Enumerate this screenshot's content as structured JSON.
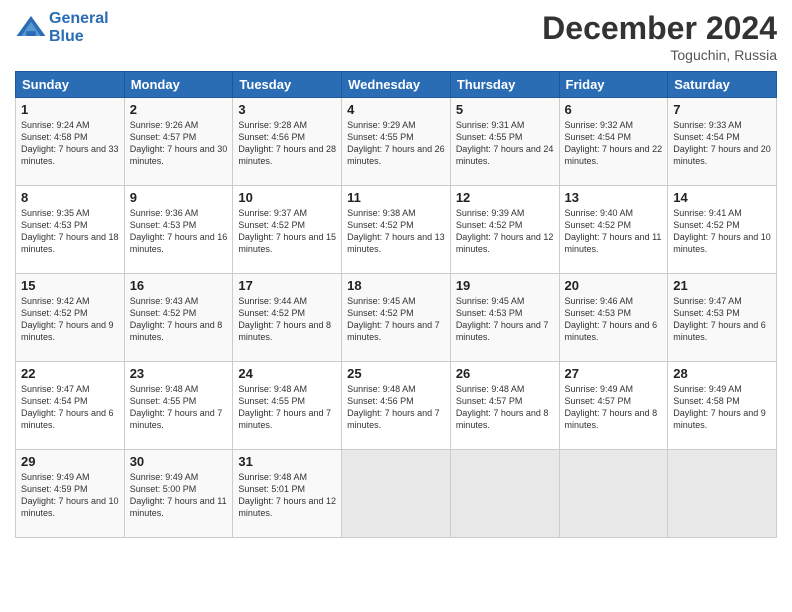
{
  "header": {
    "logo_line1": "General",
    "logo_line2": "Blue",
    "month": "December 2024",
    "location": "Toguchin, Russia"
  },
  "days_of_week": [
    "Sunday",
    "Monday",
    "Tuesday",
    "Wednesday",
    "Thursday",
    "Friday",
    "Saturday"
  ],
  "weeks": [
    [
      {
        "day": "1",
        "sunrise": "9:24 AM",
        "sunset": "4:58 PM",
        "daylight": "7 hours and 33 minutes."
      },
      {
        "day": "2",
        "sunrise": "9:26 AM",
        "sunset": "4:57 PM",
        "daylight": "7 hours and 30 minutes."
      },
      {
        "day": "3",
        "sunrise": "9:28 AM",
        "sunset": "4:56 PM",
        "daylight": "7 hours and 28 minutes."
      },
      {
        "day": "4",
        "sunrise": "9:29 AM",
        "sunset": "4:55 PM",
        "daylight": "7 hours and 26 minutes."
      },
      {
        "day": "5",
        "sunrise": "9:31 AM",
        "sunset": "4:55 PM",
        "daylight": "7 hours and 24 minutes."
      },
      {
        "day": "6",
        "sunrise": "9:32 AM",
        "sunset": "4:54 PM",
        "daylight": "7 hours and 22 minutes."
      },
      {
        "day": "7",
        "sunrise": "9:33 AM",
        "sunset": "4:54 PM",
        "daylight": "7 hours and 20 minutes."
      }
    ],
    [
      {
        "day": "8",
        "sunrise": "9:35 AM",
        "sunset": "4:53 PM",
        "daylight": "7 hours and 18 minutes."
      },
      {
        "day": "9",
        "sunrise": "9:36 AM",
        "sunset": "4:53 PM",
        "daylight": "7 hours and 16 minutes."
      },
      {
        "day": "10",
        "sunrise": "9:37 AM",
        "sunset": "4:52 PM",
        "daylight": "7 hours and 15 minutes."
      },
      {
        "day": "11",
        "sunrise": "9:38 AM",
        "sunset": "4:52 PM",
        "daylight": "7 hours and 13 minutes."
      },
      {
        "day": "12",
        "sunrise": "9:39 AM",
        "sunset": "4:52 PM",
        "daylight": "7 hours and 12 minutes."
      },
      {
        "day": "13",
        "sunrise": "9:40 AM",
        "sunset": "4:52 PM",
        "daylight": "7 hours and 11 minutes."
      },
      {
        "day": "14",
        "sunrise": "9:41 AM",
        "sunset": "4:52 PM",
        "daylight": "7 hours and 10 minutes."
      }
    ],
    [
      {
        "day": "15",
        "sunrise": "9:42 AM",
        "sunset": "4:52 PM",
        "daylight": "7 hours and 9 minutes."
      },
      {
        "day": "16",
        "sunrise": "9:43 AM",
        "sunset": "4:52 PM",
        "daylight": "7 hours and 8 minutes."
      },
      {
        "day": "17",
        "sunrise": "9:44 AM",
        "sunset": "4:52 PM",
        "daylight": "7 hours and 8 minutes."
      },
      {
        "day": "18",
        "sunrise": "9:45 AM",
        "sunset": "4:52 PM",
        "daylight": "7 hours and 7 minutes."
      },
      {
        "day": "19",
        "sunrise": "9:45 AM",
        "sunset": "4:53 PM",
        "daylight": "7 hours and 7 minutes."
      },
      {
        "day": "20",
        "sunrise": "9:46 AM",
        "sunset": "4:53 PM",
        "daylight": "7 hours and 6 minutes."
      },
      {
        "day": "21",
        "sunrise": "9:47 AM",
        "sunset": "4:53 PM",
        "daylight": "7 hours and 6 minutes."
      }
    ],
    [
      {
        "day": "22",
        "sunrise": "9:47 AM",
        "sunset": "4:54 PM",
        "daylight": "7 hours and 6 minutes."
      },
      {
        "day": "23",
        "sunrise": "9:48 AM",
        "sunset": "4:55 PM",
        "daylight": "7 hours and 7 minutes."
      },
      {
        "day": "24",
        "sunrise": "9:48 AM",
        "sunset": "4:55 PM",
        "daylight": "7 hours and 7 minutes."
      },
      {
        "day": "25",
        "sunrise": "9:48 AM",
        "sunset": "4:56 PM",
        "daylight": "7 hours and 7 minutes."
      },
      {
        "day": "26",
        "sunrise": "9:48 AM",
        "sunset": "4:57 PM",
        "daylight": "7 hours and 8 minutes."
      },
      {
        "day": "27",
        "sunrise": "9:49 AM",
        "sunset": "4:57 PM",
        "daylight": "7 hours and 8 minutes."
      },
      {
        "day": "28",
        "sunrise": "9:49 AM",
        "sunset": "4:58 PM",
        "daylight": "7 hours and 9 minutes."
      }
    ],
    [
      {
        "day": "29",
        "sunrise": "9:49 AM",
        "sunset": "4:59 PM",
        "daylight": "7 hours and 10 minutes."
      },
      {
        "day": "30",
        "sunrise": "9:49 AM",
        "sunset": "5:00 PM",
        "daylight": "7 hours and 11 minutes."
      },
      {
        "day": "31",
        "sunrise": "9:48 AM",
        "sunset": "5:01 PM",
        "daylight": "7 hours and 12 minutes."
      },
      null,
      null,
      null,
      null
    ]
  ],
  "labels": {
    "sunrise": "Sunrise:",
    "sunset": "Sunset:",
    "daylight": "Daylight:"
  }
}
